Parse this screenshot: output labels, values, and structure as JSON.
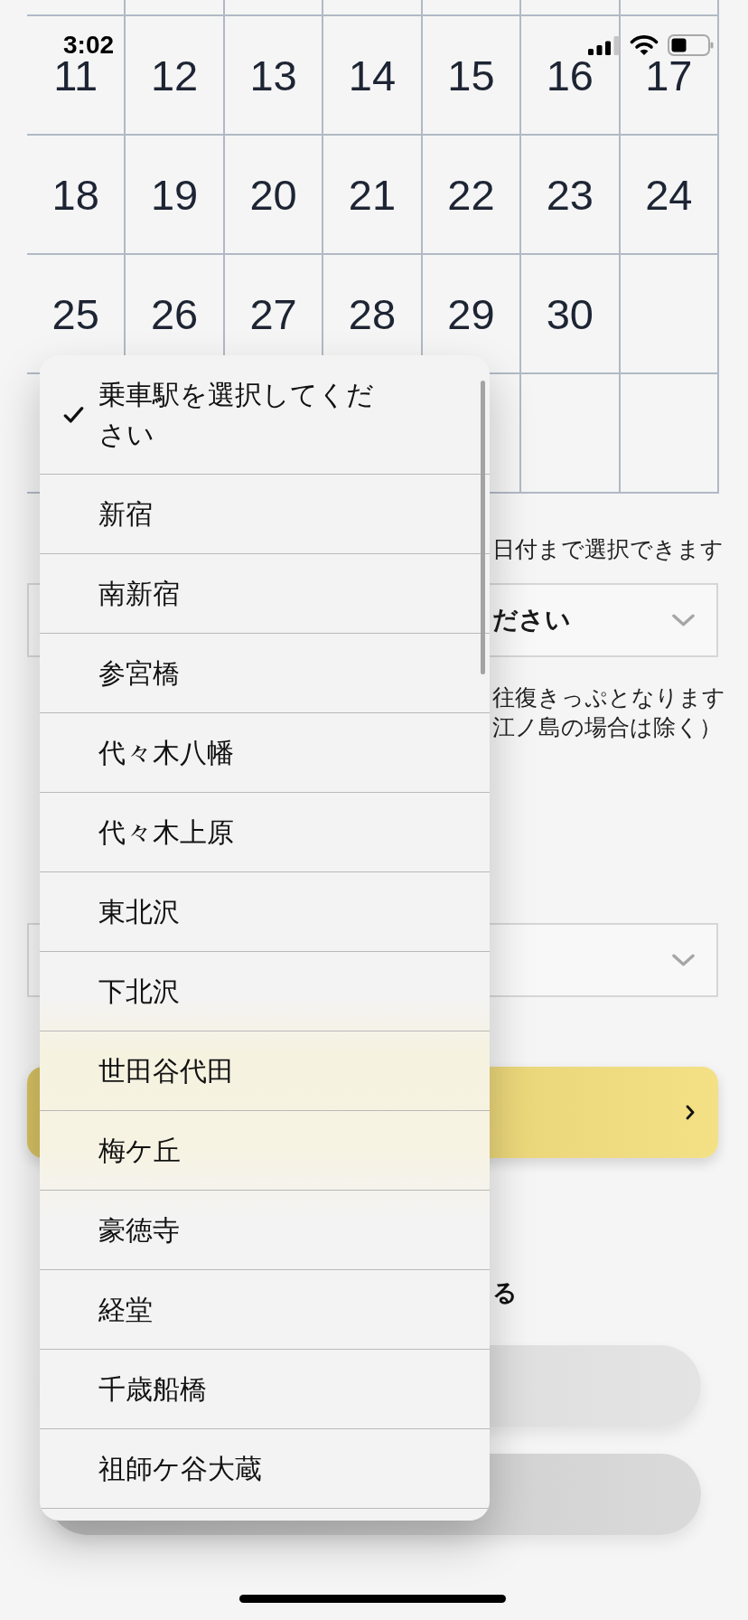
{
  "status_bar": {
    "time": "3:02"
  },
  "calendar": {
    "weeks": [
      [
        "11",
        "12",
        "13",
        "14",
        "15",
        "16",
        "17"
      ],
      [
        "18",
        "19",
        "20",
        "21",
        "22",
        "23",
        "24"
      ],
      [
        "25",
        "26",
        "27",
        "28",
        "29",
        "30"
      ]
    ]
  },
  "date_hint": "日付まで選択できます",
  "station_select": {
    "value": "ださい"
  },
  "notes": [
    "往復きっぷとなります",
    "江ノ島の場合は除く）"
  ],
  "section_heading": "る",
  "dropdown": {
    "items": [
      {
        "label": "乗車駅を選択してください",
        "selected": true
      },
      {
        "label": "新宿",
        "selected": false
      },
      {
        "label": "南新宿",
        "selected": false
      },
      {
        "label": "参宮橋",
        "selected": false
      },
      {
        "label": "代々木八幡",
        "selected": false
      },
      {
        "label": "代々木上原",
        "selected": false
      },
      {
        "label": "東北沢",
        "selected": false
      },
      {
        "label": "下北沢",
        "selected": false
      },
      {
        "label": "世田谷代田",
        "selected": false
      },
      {
        "label": "梅ケ丘",
        "selected": false
      },
      {
        "label": "豪徳寺",
        "selected": false
      },
      {
        "label": "経堂",
        "selected": false
      },
      {
        "label": "千歳船橋",
        "selected": false
      },
      {
        "label": "祖師ケ谷大蔵",
        "selected": false
      }
    ]
  }
}
